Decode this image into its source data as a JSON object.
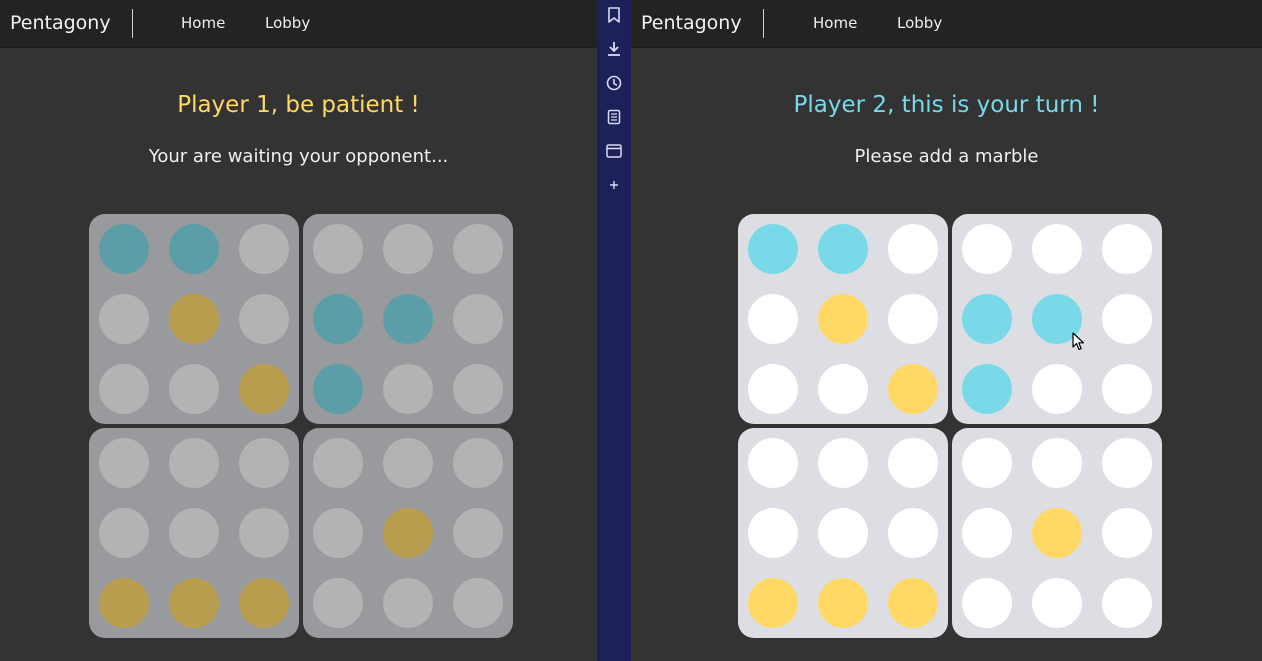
{
  "colors": {
    "navbar_bg": "#232323",
    "page_bg": "#333333",
    "sidebar_bg": "#1e2159",
    "player1": "#ffd866",
    "player2": "#7ad9e9",
    "empty": "#ffffff",
    "board_active": "#dcdee3",
    "board_inactive": "#999a9e",
    "player1_dim": "#b89d4e",
    "player2_dim": "#5b9ea8",
    "empty_dim": "#b3b3b3"
  },
  "left_pane": {
    "navbar": {
      "brand": "Pentagony",
      "links": {
        "home": "Home",
        "lobby": "Lobby"
      }
    },
    "title": "Player 1, be patient !",
    "subtitle": "Your are waiting your opponent..."
  },
  "right_pane": {
    "navbar": {
      "brand": "Pentagony",
      "links": {
        "home": "Home",
        "lobby": "Lobby"
      }
    },
    "title": "Player 2, this is your turn !",
    "subtitle": "Please add a marble"
  },
  "board": [
    [
      2,
      2,
      0,
      0,
      0,
      0
    ],
    [
      0,
      1,
      0,
      2,
      2,
      0
    ],
    [
      0,
      0,
      1,
      2,
      0,
      0
    ],
    [
      0,
      0,
      0,
      0,
      0,
      0
    ],
    [
      0,
      0,
      0,
      0,
      1,
      0
    ],
    [
      1,
      1,
      1,
      0,
      0,
      0
    ]
  ],
  "sidebar": {
    "icons": [
      "bookmark-icon",
      "download-icon",
      "history-icon",
      "notes-icon",
      "window-icon",
      "add-icon"
    ]
  }
}
